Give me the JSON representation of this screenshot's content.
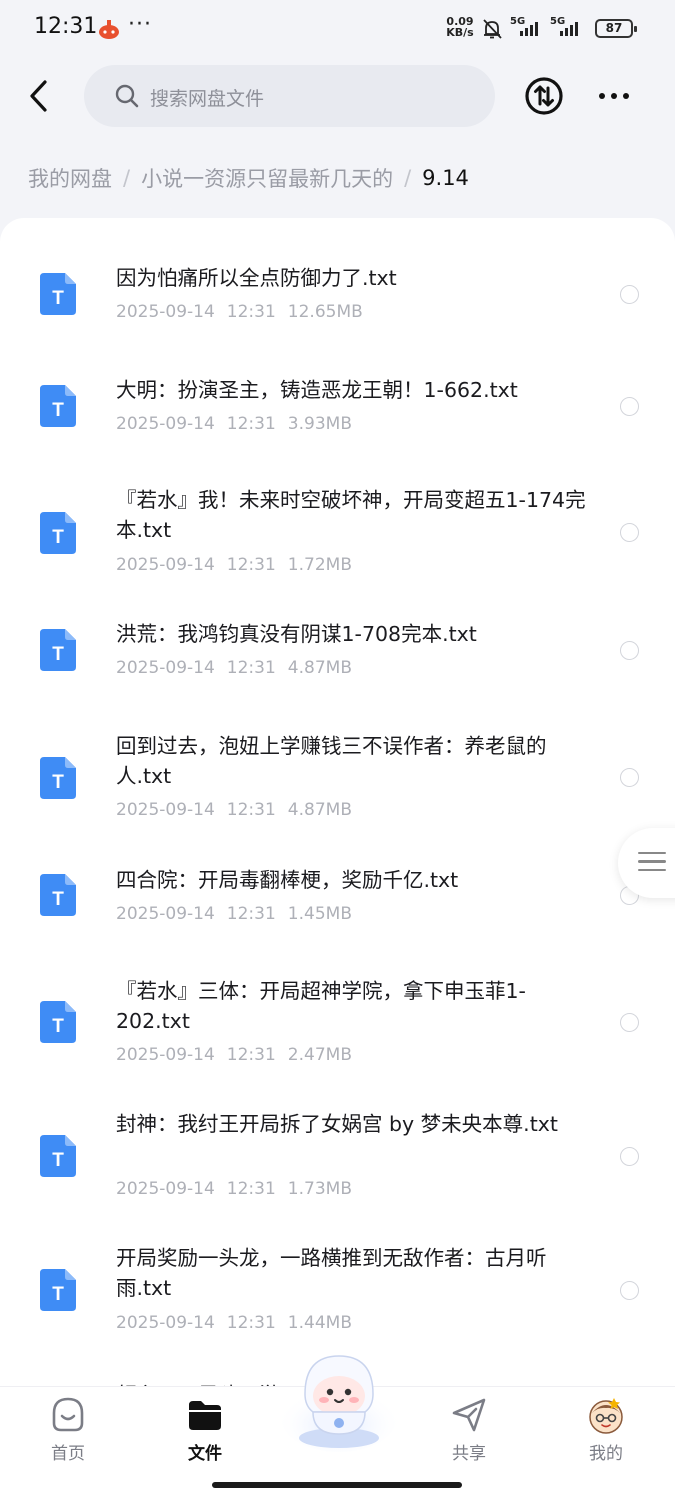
{
  "status_bar": {
    "time": "12:31",
    "more": "···",
    "net_speed_value": "0.09",
    "net_speed_unit": "KB/s",
    "signal_1": "5G",
    "signal_2": "5G",
    "battery": "87"
  },
  "header": {
    "search_placeholder": "搜索网盘文件"
  },
  "breadcrumb": {
    "items": [
      "我的网盘",
      "小说一资源只留最新几天的",
      "9.14"
    ],
    "separator": "/"
  },
  "files": [
    {
      "name": "因为怕痛所以全点防御力了.txt",
      "date": "2025-09-14",
      "time": "12:31",
      "size": "12.65MB"
    },
    {
      "name": "大明：扮演圣主，铸造恶龙王朝！1-662.txt",
      "date": "2025-09-14",
      "time": "12:31",
      "size": "3.93MB"
    },
    {
      "name": "『若水』我！未来时空破坏神，开局变超五1-174完本.txt",
      "date": "2025-09-14",
      "time": "12:31",
      "size": "1.72MB"
    },
    {
      "name": "洪荒：我鸿钧真没有阴谋1-708完本.txt",
      "date": "2025-09-14",
      "time": "12:31",
      "size": "4.87MB"
    },
    {
      "name": "回到过去，泡妞上学赚钱三不误作者：养老鼠的人.txt",
      "date": "2025-09-14",
      "time": "12:31",
      "size": "4.87MB"
    },
    {
      "name": "四合院：开局毒翻棒梗，奖励千亿.txt",
      "date": "2025-09-14",
      "time": "12:31",
      "size": "1.45MB"
    },
    {
      "name": "『若水』三体：开局超神学院，拿下申玉菲1-202.txt",
      "date": "2025-09-14",
      "time": "12:31",
      "size": "2.47MB"
    },
    {
      "name": "封神：我纣王开局拆了女娲宫 by 梦未央本尊.txt",
      "date": "2025-09-14",
      "time": "12:31",
      "size": "1.73MB"
    },
    {
      "name": "开局奖励一头龙，一路横推到无敌作者：古月听雨.txt",
      "date": "2025-09-14",
      "time": "12:31",
      "size": "1.44MB"
    }
  ],
  "file_icon_letter": "T",
  "partial_row_text": "领主：开局建西游",
  "bottom_nav": {
    "items": [
      {
        "label": "首页",
        "icon": "home-icon"
      },
      {
        "label": "文件",
        "icon": "folder-icon"
      },
      {
        "label": "共享",
        "icon": "share-icon"
      },
      {
        "label": "我的",
        "icon": "avatar-icon"
      }
    ],
    "active": "文件"
  },
  "colors": {
    "accent_blue": "#3f8cf5",
    "background": "#f3f4f8",
    "panel": "#ffffff",
    "meta_gray": "#aeb0b7"
  }
}
